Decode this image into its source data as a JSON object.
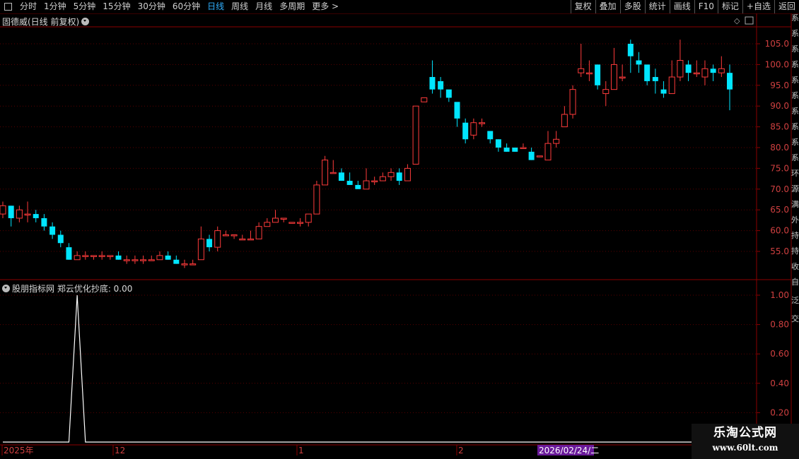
{
  "toolbar": {
    "left": [
      "分时",
      "1分钟",
      "5分钟",
      "15分钟",
      "30分钟",
      "60分钟",
      "日线",
      "周线",
      "月线",
      "多周期",
      "更多 >"
    ],
    "active": "日线",
    "right": [
      "复权",
      "叠加",
      "多股",
      "统计",
      "画线",
      "F10",
      "标记",
      "+自选",
      "返回"
    ]
  },
  "main_panel": {
    "title": "固德威(日线 前复权)"
  },
  "indicator_panel": {
    "title": "股朋指标网 郑云优化抄底: 0.00"
  },
  "x_axis": {
    "labels": [
      "2025年",
      "12",
      "1",
      "2"
    ],
    "cursor_date": "2026/02/24/二"
  },
  "watermark": {
    "line1": "乐淘公式网",
    "line2": "www.60lt.com"
  },
  "colors": {
    "up": "#ff3b3b",
    "down": "#00e5ff",
    "grid": "#5a0000",
    "axis": "#8b0000",
    "cursor_bg": "#6a1a9a"
  },
  "chart_data": [
    {
      "type": "candlestick",
      "y_ticks": [
        55,
        60,
        65,
        70,
        75,
        80,
        85,
        90,
        95,
        100,
        105
      ],
      "ylim": [
        50,
        110
      ],
      "candles": [
        [
          64,
          66,
          67,
          63
        ],
        [
          66,
          63,
          66,
          61
        ],
        [
          63,
          65,
          66,
          62
        ],
        [
          64,
          64,
          67,
          62
        ],
        [
          64,
          63,
          65,
          62
        ],
        [
          63,
          61,
          64,
          60
        ],
        [
          61,
          59,
          62,
          58
        ],
        [
          59,
          57,
          60,
          56
        ],
        [
          56,
          53,
          57,
          53
        ],
        [
          53,
          54,
          55,
          53
        ],
        [
          54,
          54,
          55,
          53
        ],
        [
          54,
          54,
          54,
          53
        ],
        [
          54,
          54,
          55,
          53
        ],
        [
          54,
          54,
          54,
          53
        ],
        [
          54,
          53,
          55,
          53
        ],
        [
          53,
          53,
          54,
          52
        ],
        [
          53,
          53,
          54,
          52
        ],
        [
          53,
          53,
          54,
          52
        ],
        [
          53,
          53,
          54,
          53
        ],
        [
          53,
          54,
          55,
          53
        ],
        [
          54,
          53,
          55,
          53
        ],
        [
          53,
          52,
          54,
          52
        ],
        [
          52,
          52,
          53,
          51
        ],
        [
          52,
          52,
          53,
          52
        ],
        [
          53,
          58,
          61,
          53
        ],
        [
          58,
          56,
          59,
          55
        ],
        [
          56,
          60,
          61,
          55
        ],
        [
          59,
          59,
          60,
          59
        ],
        [
          59,
          59,
          59,
          58
        ],
        [
          58,
          58,
          59,
          58
        ],
        [
          58,
          58,
          60,
          58
        ],
        [
          58,
          61,
          62,
          58
        ],
        [
          61,
          62,
          63,
          61
        ],
        [
          62,
          63,
          65,
          62
        ],
        [
          63,
          63,
          63,
          62
        ],
        [
          62,
          62,
          62,
          62
        ],
        [
          62,
          62,
          63,
          61
        ],
        [
          62,
          64,
          64,
          61
        ],
        [
          64,
          71,
          72,
          64
        ],
        [
          71,
          77,
          78,
          71
        ],
        [
          74,
          74,
          77,
          74
        ],
        [
          74,
          72,
          75,
          72
        ],
        [
          72,
          71,
          74,
          71
        ],
        [
          71,
          70,
          72,
          70
        ],
        [
          70,
          72,
          75,
          70
        ],
        [
          72,
          72,
          73,
          71
        ],
        [
          72,
          73,
          74,
          72
        ],
        [
          73,
          74,
          75,
          72
        ],
        [
          74,
          72,
          75,
          71
        ],
        [
          72,
          75,
          76,
          72
        ],
        [
          76,
          90,
          90,
          76
        ],
        [
          91,
          92,
          92,
          91
        ],
        [
          97,
          94,
          101,
          93
        ],
        [
          96,
          94,
          97,
          92
        ],
        [
          94,
          92,
          93,
          91
        ],
        [
          91,
          87,
          90,
          85
        ],
        [
          86,
          82,
          87,
          81
        ],
        [
          83,
          86,
          87,
          82
        ],
        [
          86,
          86,
          87,
          85
        ],
        [
          84,
          82,
          84,
          81
        ],
        [
          82,
          80,
          82,
          79
        ],
        [
          80,
          79,
          81,
          79
        ],
        [
          80,
          79,
          80,
          79
        ],
        [
          80,
          80,
          81,
          80
        ],
        [
          79,
          77,
          80,
          77
        ],
        [
          78,
          78,
          78,
          78
        ],
        [
          77,
          81,
          84,
          77
        ],
        [
          81,
          82,
          84,
          80
        ],
        [
          85,
          88,
          90,
          85
        ],
        [
          88,
          94,
          95,
          87
        ],
        [
          98,
          99,
          105,
          97
        ],
        [
          98,
          98,
          101,
          96
        ],
        [
          100,
          95,
          100,
          94
        ],
        [
          93,
          94,
          96,
          90
        ],
        [
          94,
          100,
          104,
          94
        ],
        [
          97,
          97,
          100,
          96
        ],
        [
          105,
          102,
          106,
          98
        ],
        [
          101,
          100,
          103,
          98
        ],
        [
          100,
          96,
          99,
          95
        ],
        [
          97,
          96,
          99,
          93
        ],
        [
          94,
          93,
          96,
          92
        ],
        [
          93,
          97,
          101,
          93
        ],
        [
          97,
          101,
          106,
          96
        ],
        [
          100,
          98,
          101,
          96
        ],
        [
          98,
          98,
          101,
          97
        ],
        [
          97,
          99,
          101,
          95
        ],
        [
          99,
          98,
          100,
          96
        ],
        [
          98,
          99,
          102,
          97
        ],
        [
          98,
          94,
          100,
          89
        ]
      ]
    },
    {
      "type": "line",
      "name": "郑云优化抄底",
      "y_ticks": [
        0.2,
        0.4,
        0.6,
        0.8,
        1.0
      ],
      "ylim": [
        0,
        1.0
      ],
      "values": [
        0,
        0,
        0,
        0,
        0,
        0,
        0,
        0,
        0,
        1,
        0,
        0,
        0,
        0,
        0,
        0,
        0,
        0,
        0,
        0,
        0,
        0,
        0,
        0,
        0,
        0,
        0,
        0,
        0,
        0,
        0,
        0,
        0,
        0,
        0,
        0,
        0,
        0,
        0,
        0,
        0,
        0,
        0,
        0,
        0,
        0,
        0,
        0,
        0,
        0,
        0,
        0,
        0,
        0,
        0,
        0,
        0,
        0,
        0,
        0,
        0,
        0,
        0,
        0,
        0,
        0,
        0,
        0,
        0,
        0,
        0,
        0,
        0,
        0,
        0,
        0,
        0,
        0,
        0,
        0,
        0,
        0,
        0,
        0,
        0,
        0,
        0,
        0,
        0
      ]
    }
  ],
  "right_col_text": "系系系系系系系系系系环源满外持持收自泛交"
}
